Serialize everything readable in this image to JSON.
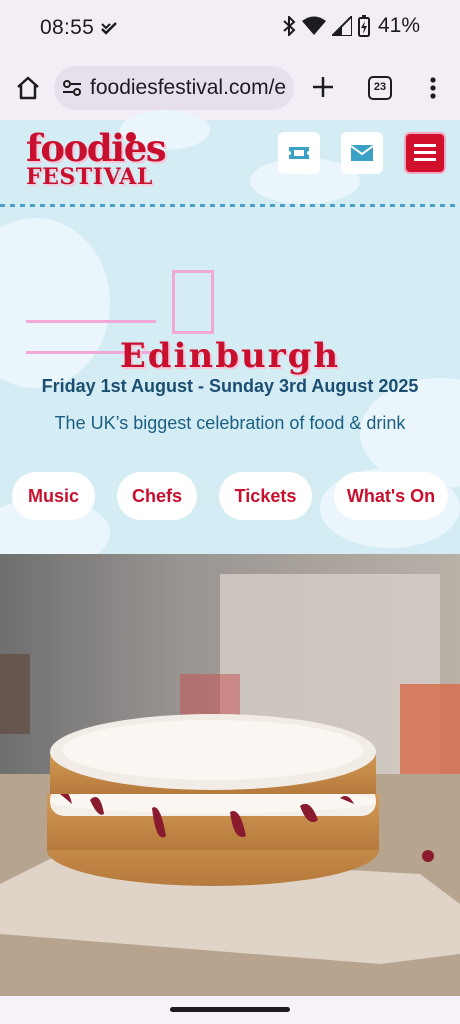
{
  "status_bar": {
    "time": "08:55",
    "battery": "41%",
    "icons": [
      "bluetooth-icon",
      "wifi-icon",
      "signal-icon",
      "battery-icon"
    ]
  },
  "browser": {
    "url": "foodiesfestival.com/e",
    "tab_count": "23"
  },
  "site": {
    "logo_top": "foodies",
    "logo_bottom": "FESTIVAL",
    "header_buttons": [
      "ticket-icon",
      "mail-icon",
      "hamburger-icon"
    ],
    "colors": {
      "brand_red": "#c8102e",
      "sky_blue": "#d4ecf4",
      "pink_accent": "#f2a7d8"
    }
  },
  "hero": {
    "city": "Edinburgh",
    "dates": "Friday 1st August - Sunday 3rd August 2025",
    "tagline": "The UK’s biggest celebration of food & drink",
    "nav": {
      "music": "Music",
      "chefs": "Chefs",
      "tickets": "Tickets",
      "whats_on": "What's On"
    }
  }
}
